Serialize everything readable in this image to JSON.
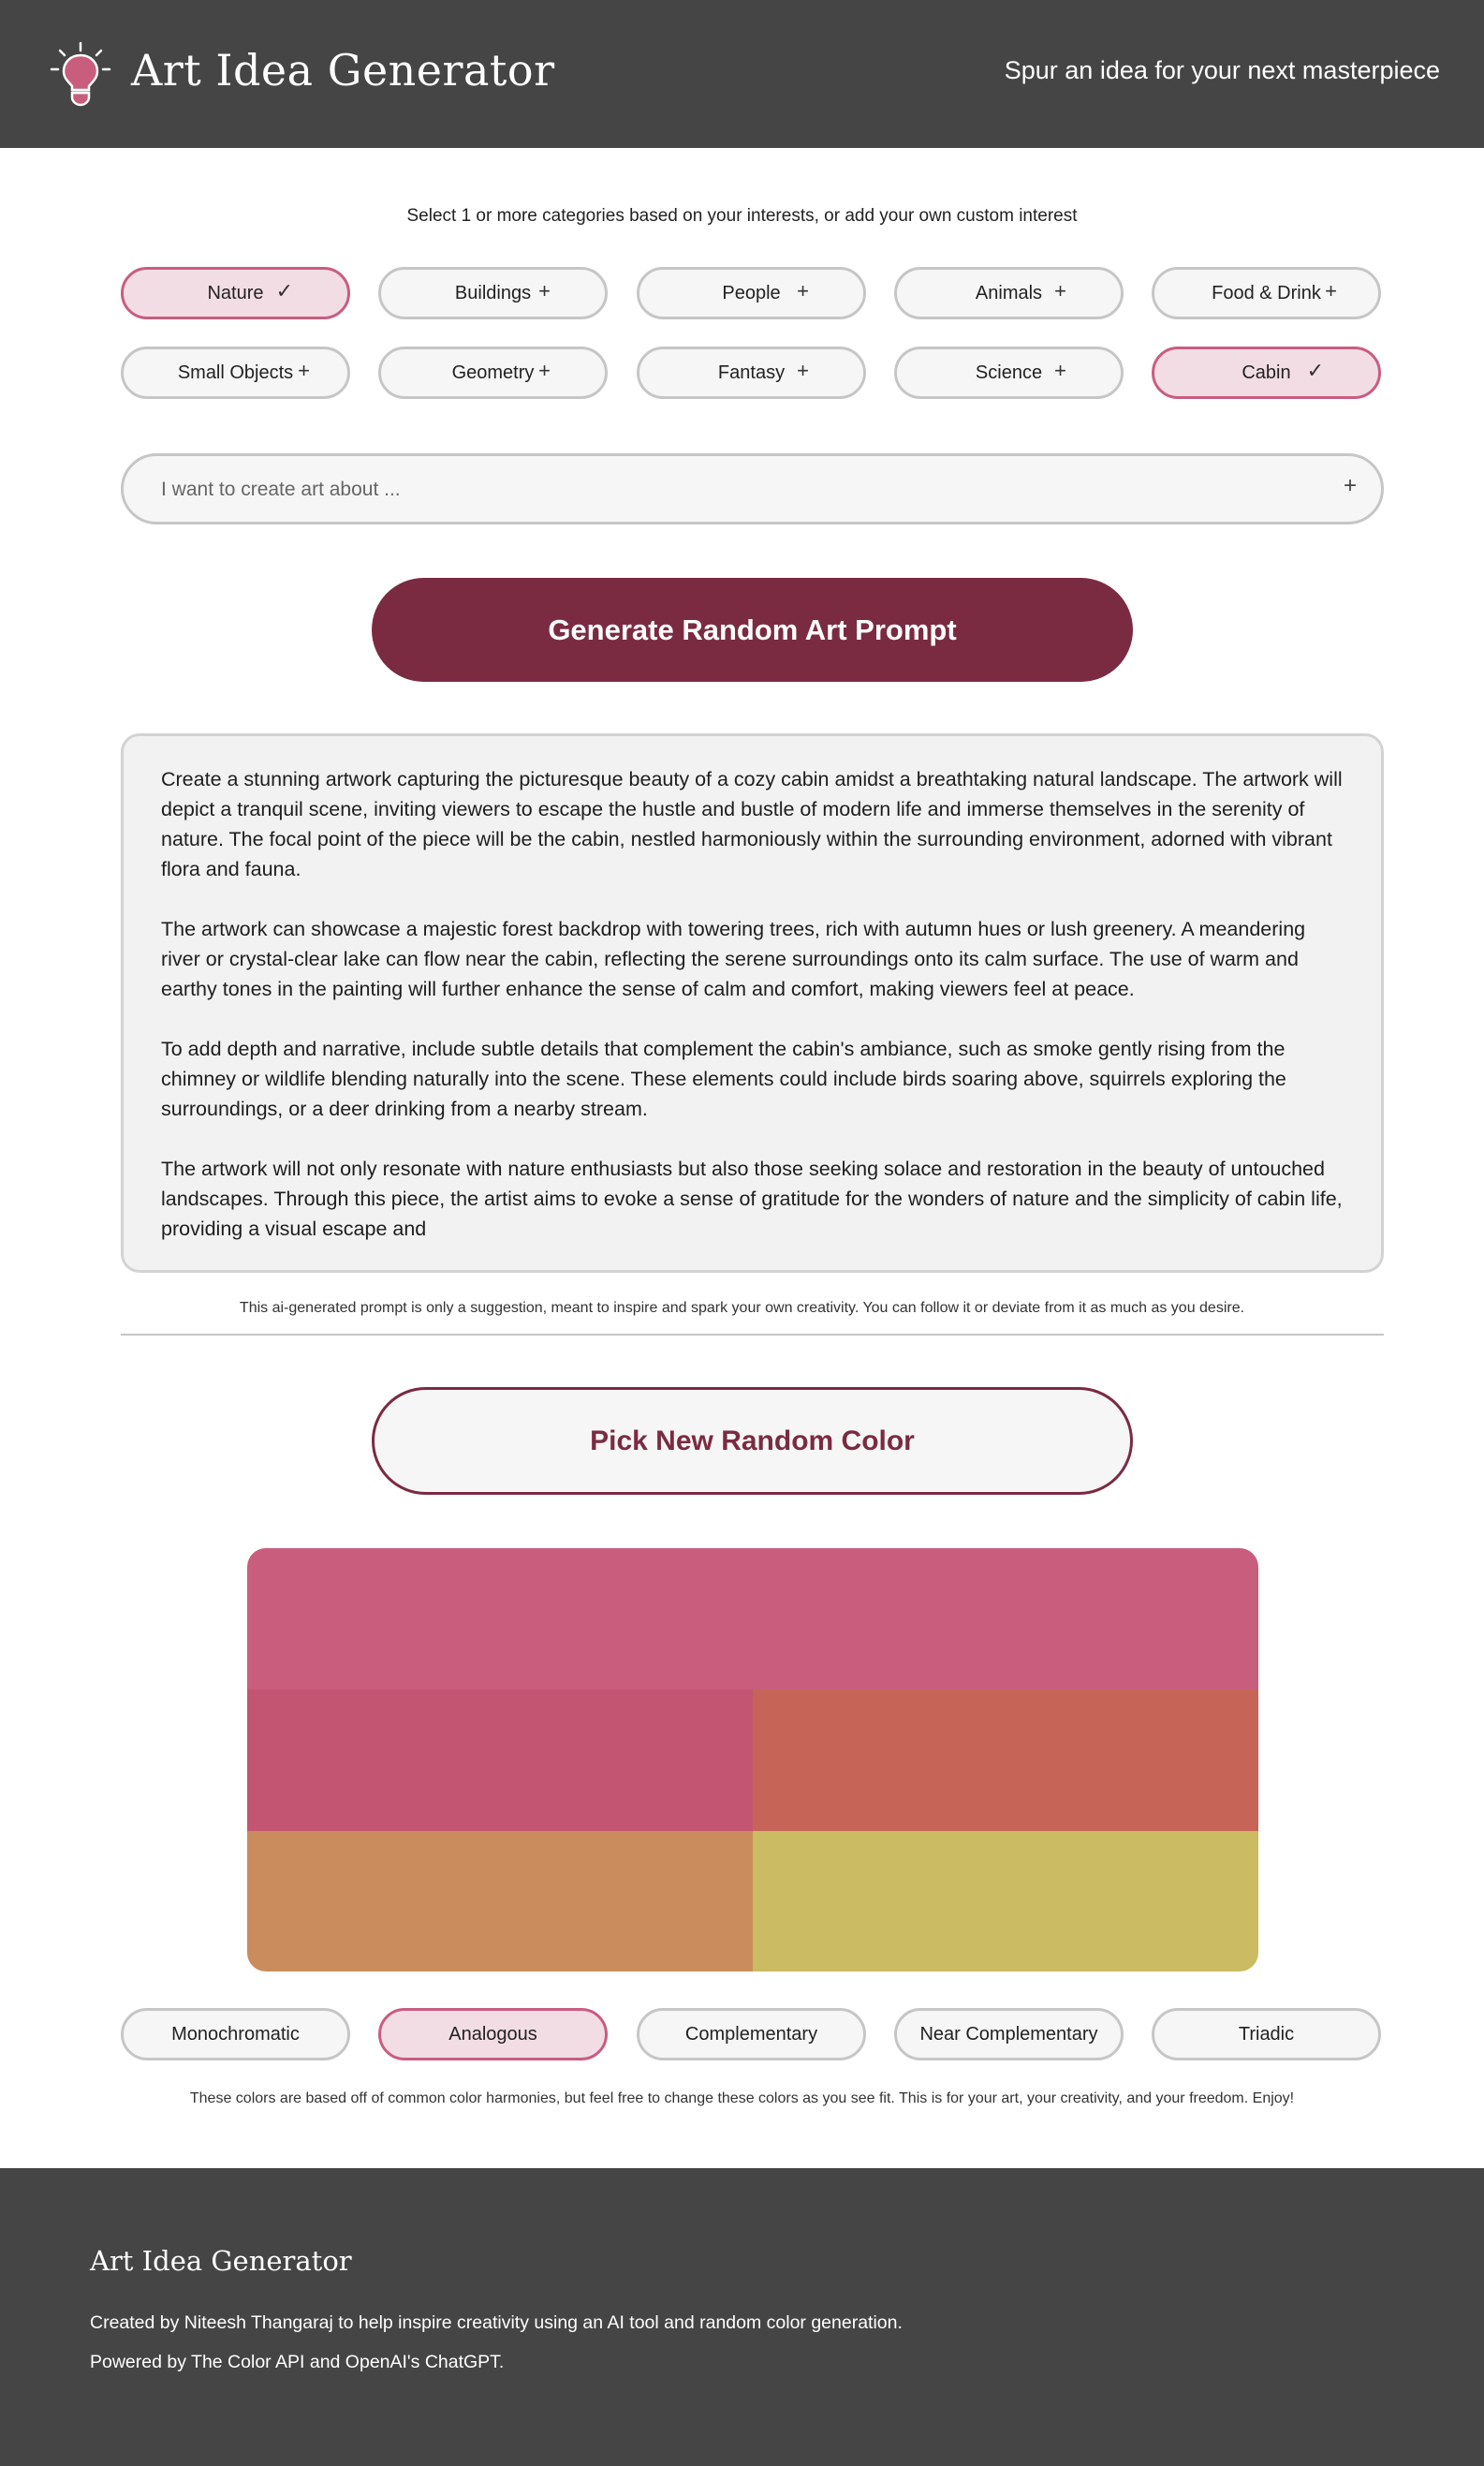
{
  "header": {
    "title": "Art Idea Generator",
    "tagline": "Spur an idea for your next masterpiece",
    "logo_icon": "lightbulb-icon"
  },
  "categories": {
    "instructions": "Select 1 or more categories based on your interests, or add your own custom interest",
    "items": [
      {
        "label": "Nature",
        "selected": true
      },
      {
        "label": "Buildings",
        "selected": false
      },
      {
        "label": "People",
        "selected": false
      },
      {
        "label": "Animals",
        "selected": false
      },
      {
        "label": "Food & Drink",
        "selected": false
      },
      {
        "label": "Small Objects",
        "selected": false
      },
      {
        "label": "Geometry",
        "selected": false
      },
      {
        "label": "Fantasy",
        "selected": false
      },
      {
        "label": "Science",
        "selected": false
      },
      {
        "label": "Cabin",
        "selected": true
      }
    ],
    "selected_symbol": "✓",
    "add_symbol": "+"
  },
  "custom_interest": {
    "placeholder": "I want to create art about ...",
    "value": "",
    "add_symbol": "+"
  },
  "generate_button": {
    "label": "Generate Random Art Prompt"
  },
  "prompt": {
    "paragraphs": [
      "Create a stunning artwork capturing the picturesque beauty of a cozy cabin amidst a breathtaking natural landscape. The artwork will depict a tranquil scene, inviting viewers to escape the hustle and bustle of modern life and immerse themselves in the serenity of nature. The focal point of the piece will be the cabin, nestled harmoniously within the surrounding environment, adorned with vibrant flora and fauna.",
      "The artwork can showcase a majestic forest backdrop with towering trees, rich with autumn hues or lush greenery. A meandering river or crystal-clear lake can flow near the cabin, reflecting the serene surroundings onto its calm surface. The use of warm and earthy tones in the painting will further enhance the sense of calm and comfort, making viewers feel at peace.",
      "To add depth and narrative, include subtle details that complement the cabin's ambiance, such as smoke gently rising from the chimney or wildlife blending naturally into the scene. These elements could include birds soaring above, squirrels exploring the surroundings, or a deer drinking from a nearby stream.",
      "The artwork will not only resonate with nature enthusiasts but also those seeking solace and restoration in the beauty of untouched landscapes. Through this piece, the artist aims to evoke a sense of gratitude for the wonders of nature and the simplicity of cabin life, providing a visual escape and"
    ],
    "disclaimer": "This ai-generated prompt is only a suggestion, meant to inspire and spark your own creativity. You can follow it or deviate from it as much as you desire."
  },
  "color": {
    "pick_button": {
      "label": "Pick New Random Color"
    },
    "palette": [
      "#c95d7d",
      "#c35572",
      "#c66458",
      "#cb8c5d",
      "#cbbb62"
    ],
    "harmonies": [
      {
        "label": "Monochromatic",
        "selected": false
      },
      {
        "label": "Analogous",
        "selected": true
      },
      {
        "label": "Complementary",
        "selected": false
      },
      {
        "label": "Near Complementary",
        "selected": false
      },
      {
        "label": "Triadic",
        "selected": false
      }
    ],
    "note": "These colors are based off of common color harmonies, but feel free to change these colors as you see fit. This is for your art, your creativity, and your freedom. Enjoy!"
  },
  "footer": {
    "title": "Art Idea Generator",
    "credit": "Created by Niteesh Thangaraj to help inspire creativity using an AI tool and random color generation.",
    "powered_by": "Powered by The Color API and OpenAI's ChatGPT."
  },
  "theme": {
    "accent": "#7a2b42",
    "selected_border": "#c95d80",
    "selected_fill": "#f3dde4",
    "header_bg": "#454545"
  }
}
